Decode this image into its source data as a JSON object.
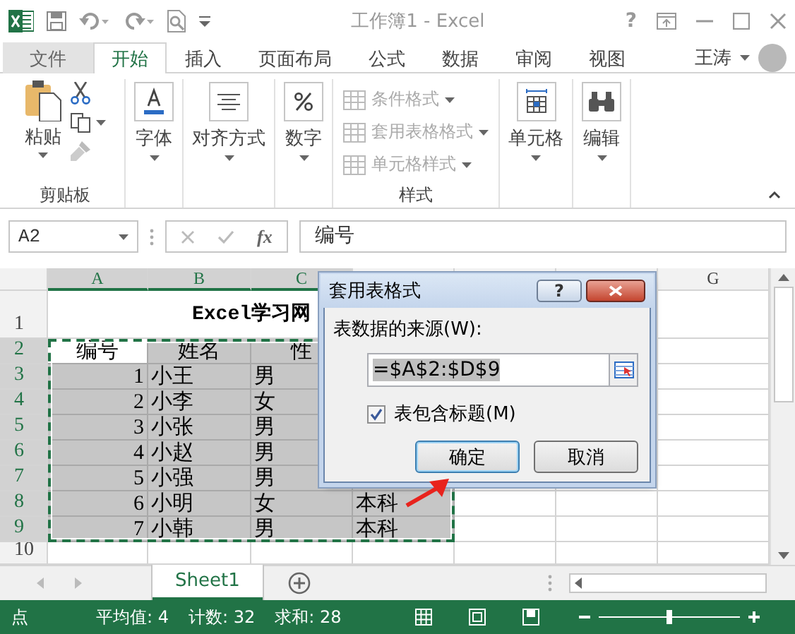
{
  "window": {
    "title": "工作簿1 - Excel",
    "help": "?"
  },
  "tabs": [
    {
      "label": "文件",
      "kind": "file",
      "selected": false
    },
    {
      "label": "开始",
      "kind": "tab",
      "selected": true
    },
    {
      "label": "插入",
      "kind": "tab",
      "selected": false
    },
    {
      "label": "页面布局",
      "kind": "tab",
      "selected": false
    },
    {
      "label": "公式",
      "kind": "tab",
      "selected": false
    },
    {
      "label": "数据",
      "kind": "tab",
      "selected": false
    },
    {
      "label": "审阅",
      "kind": "tab",
      "selected": false
    },
    {
      "label": "视图",
      "kind": "tab",
      "selected": false
    }
  ],
  "user": {
    "name": "王涛"
  },
  "ribbon": {
    "groups": [
      {
        "kind": "clipboard",
        "label": "剪贴板",
        "button": "粘贴"
      },
      {
        "kind": "font",
        "button": "字体"
      },
      {
        "kind": "align",
        "button": "对齐方式"
      },
      {
        "kind": "number",
        "button": "数字"
      },
      {
        "kind": "styles",
        "label": "样式",
        "items": [
          {
            "label": "条件格式",
            "disabled": true
          },
          {
            "label": "套用表格格式",
            "disabled": true
          },
          {
            "label": "单元格样式",
            "disabled": true
          }
        ]
      },
      {
        "kind": "cells",
        "button": "单元格"
      },
      {
        "kind": "editing",
        "button": "编辑"
      }
    ]
  },
  "formula_bar": {
    "name_box": "A2",
    "function_label": "fx",
    "formula": "编号"
  },
  "sheet": {
    "columns": [
      {
        "label": "A",
        "selected": true
      },
      {
        "label": "B",
        "selected": true
      },
      {
        "label": "C",
        "selected": true
      },
      {
        "label": "G",
        "selected": false
      }
    ],
    "title_cell": "Excel学习网",
    "rows": [
      {
        "number": "1",
        "selected": false,
        "kind": "title",
        "cells": []
      },
      {
        "number": "2",
        "selected": true,
        "kind": "header",
        "cells": [
          {
            "text": "编号",
            "active": true
          },
          {
            "text": "姓名",
            "active": false
          },
          {
            "text": "性",
            "active": false
          }
        ]
      },
      {
        "number": "3",
        "selected": true,
        "kind": "data",
        "cells": [
          {
            "text": "1",
            "active": false
          },
          {
            "text": "小王",
            "active": false
          },
          {
            "text": "男",
            "active": false
          }
        ]
      },
      {
        "number": "4",
        "selected": true,
        "kind": "data",
        "cells": [
          {
            "text": "2",
            "active": false
          },
          {
            "text": "小李",
            "active": false
          },
          {
            "text": "女",
            "active": false
          }
        ]
      },
      {
        "number": "5",
        "selected": true,
        "kind": "data",
        "cells": [
          {
            "text": "3",
            "active": false
          },
          {
            "text": "小张",
            "active": false
          },
          {
            "text": "男",
            "active": false
          }
        ]
      },
      {
        "number": "6",
        "selected": true,
        "kind": "data",
        "cells": [
          {
            "text": "4",
            "active": false
          },
          {
            "text": "小赵",
            "active": false
          },
          {
            "text": "男",
            "active": false
          }
        ]
      },
      {
        "number": "7",
        "selected": true,
        "kind": "data",
        "cells": [
          {
            "text": "5",
            "active": false
          },
          {
            "text": "小强",
            "active": false
          },
          {
            "text": "男",
            "active": false
          }
        ]
      },
      {
        "number": "8",
        "selected": true,
        "kind": "data",
        "cells": [
          {
            "text": "6",
            "active": false
          },
          {
            "text": "小明",
            "active": false
          },
          {
            "text": "女",
            "active": false
          },
          {
            "text": "本科",
            "active": false
          }
        ]
      },
      {
        "number": "9",
        "selected": true,
        "kind": "data",
        "cells": [
          {
            "text": "7",
            "active": false
          },
          {
            "text": "小韩",
            "active": false
          },
          {
            "text": "男",
            "active": false
          },
          {
            "text": "本科",
            "active": false
          }
        ]
      },
      {
        "number": "10",
        "selected": false,
        "kind": "data",
        "cells": []
      }
    ]
  },
  "dialog": {
    "title": "套用表格式",
    "help": "?",
    "source_label": "表数据的来源(W):",
    "source_value": "=$A$2:$D$9",
    "header_option": {
      "label": "表包含标题(M)",
      "checked": true
    },
    "buttons": [
      {
        "label": "确定",
        "default": true
      },
      {
        "label": "取消",
        "default": false
      }
    ]
  },
  "sheet_tabs": [
    {
      "label": "Sheet1",
      "selected": true
    }
  ],
  "status_bar": {
    "mode": "点",
    "stats": [
      "平均值: 4",
      "计数: 32",
      "求和: 28"
    ],
    "zoom_slider": {
      "level": 0.5
    }
  }
}
